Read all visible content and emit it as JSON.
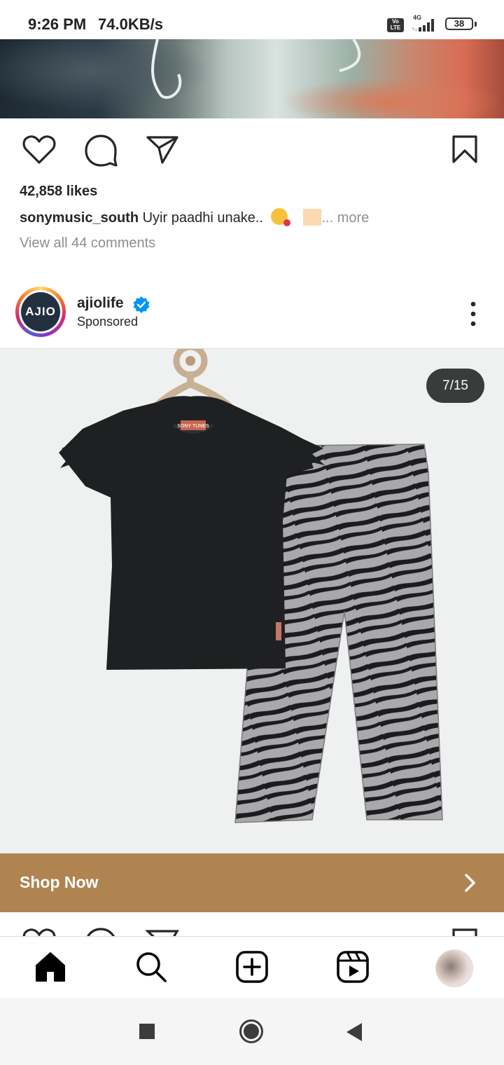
{
  "status_bar": {
    "time": "9:26 PM",
    "speed": "74.0KB/s",
    "volte": "Vo LTE",
    "network": "4G",
    "battery": "38"
  },
  "previous_post": {
    "likes": "42,858 likes",
    "caption_user": "sonymusic_south",
    "caption_text": " Uyir paadhi unake.. ",
    "more": "... more",
    "view_comments": "View all 44 comments"
  },
  "ad_post": {
    "avatar_text": "AJIO",
    "username": "ajiolife",
    "sponsored": "Sponsored",
    "image_counter": "7/15",
    "tshirt_tag": "SONY TUNES",
    "cta_label": "Shop Now"
  },
  "colors": {
    "cta_background": "#b08451",
    "verified_blue": "#0095f6",
    "counter_background": "#3a3b3b"
  },
  "icons": {
    "post_actions": [
      "heart-icon",
      "comment-icon",
      "share-icon",
      "bookmark-icon"
    ],
    "bottom_nav": [
      "home-icon",
      "search-icon",
      "create-post-icon",
      "reels-icon",
      "profile-avatar"
    ],
    "system_nav": [
      "recents-square-icon",
      "home-circle-icon",
      "back-triangle-icon"
    ]
  }
}
